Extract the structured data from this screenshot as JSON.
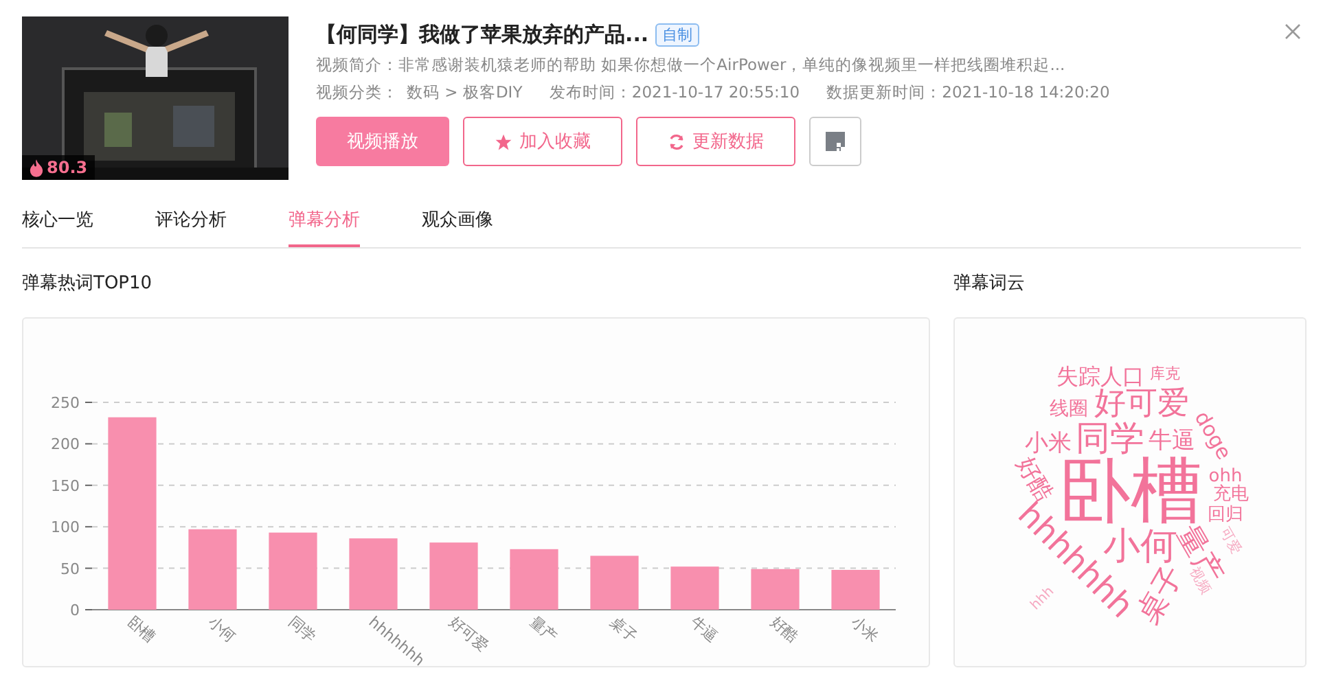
{
  "video": {
    "title": "【何同学】我做了苹果放弃的产品...",
    "badge": "自制",
    "heat": "80.3",
    "intro_label": "视频简介：",
    "intro": "非常感谢装机猿老师的帮助 如果你想做一个AirPower，单纯的像视频里一样把线圈堆积起...",
    "category_label": "视频分类：",
    "category": "数码 > 极客DIY",
    "published_label": "发布时间：",
    "published": "2021-10-17 20:55:10",
    "updated_label": "数据更新时间：",
    "updated": "2021-10-18 14:20:20"
  },
  "actions": [
    {
      "kind": "primary",
      "label": "视频播放"
    },
    {
      "kind": "star",
      "label": "加入收藏"
    },
    {
      "kind": "refresh",
      "label": "更新数据"
    },
    {
      "kind": "qr"
    }
  ],
  "tabs": [
    {
      "label": "核心一览",
      "selected": false
    },
    {
      "label": "评论分析",
      "selected": false
    },
    {
      "label": "弹幕分析",
      "selected": true
    },
    {
      "label": "观众画像",
      "selected": false
    }
  ],
  "top_words": {
    "title": "弹幕热词TOP10",
    "chart_data": {
      "type": "bar",
      "categories": [
        "卧槽",
        "小何",
        "同学",
        "hhhhhhh",
        "好可爱",
        "量产",
        "桌子",
        "牛逼",
        "好酷",
        "小米"
      ],
      "values": [
        232,
        97,
        93,
        86,
        81,
        73,
        65,
        52,
        49,
        48
      ],
      "grid": true,
      "ylim": [
        0,
        250
      ],
      "yticks": [
        0,
        50,
        100,
        150,
        200,
        250
      ]
    }
  },
  "word_cloud": {
    "title": "弹幕词云",
    "words": [
      "失踪人口",
      "库克",
      "线圈",
      "好可爱",
      "doge",
      "小米",
      "同学",
      "牛逼",
      "好酷",
      "卧槽",
      "ohh",
      "充电",
      "回归",
      "hhhhhhh",
      "小何",
      "量产",
      "桌子",
      "可爱",
      "视频",
      "hhh"
    ]
  }
}
